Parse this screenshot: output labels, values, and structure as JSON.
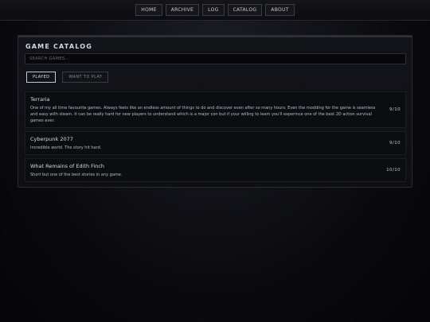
{
  "nav": {
    "items": [
      "HOME",
      "ARCHIVE",
      "LOG",
      "CATALOG",
      "ABOUT"
    ]
  },
  "catalog": {
    "title": "GAME CATALOG",
    "search_placeholder": "SEARCH GAMES...",
    "tabs": [
      {
        "label": "PLAYED",
        "active": true
      },
      {
        "label": "WANT TO PLAY",
        "active": false
      }
    ],
    "games": [
      {
        "name": "Terraria",
        "description": "One of my all time favourite games. Always feels like an endless amount of things to do and discover even after so many hours. Even the modding for the game is seamless and easy with steam. It can be really hard for new players to understand which is a major con but if your willing to learn you'll experince one of the best 2D action survival games ever.",
        "score": "9/10"
      },
      {
        "name": "Cyberpunk 2077",
        "description": "Incredible world. The story hit hard.",
        "score": "9/10"
      },
      {
        "name": "What Remains of Edith Finch",
        "description": "Short but one of the best stories in any game.",
        "score": "10/10"
      }
    ]
  }
}
